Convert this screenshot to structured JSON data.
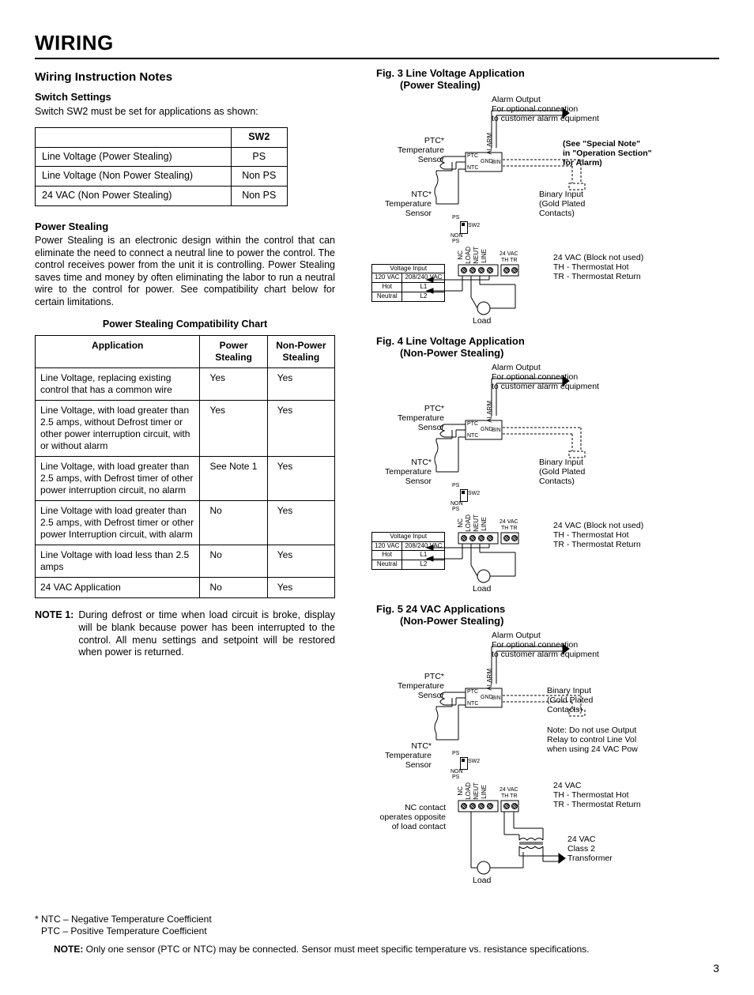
{
  "title": "WIRING",
  "page_number": "3",
  "left": {
    "heading": "Wiring Instruction Notes",
    "switch_heading": "Switch Settings",
    "switch_intro": "Switch SW2 must be set for applications as shown:",
    "sw_table": {
      "header": "SW2",
      "rows": [
        {
          "app": "Line Voltage (Power Stealing)",
          "val": "PS"
        },
        {
          "app": "Line Voltage (Non Power Stealing)",
          "val": "Non PS"
        },
        {
          "app": "24 VAC (Non Power Stealing)",
          "val": "Non PS"
        }
      ]
    },
    "ps_heading": "Power Stealing",
    "ps_text": "Power Stealing is an electronic design within the control that can eliminate the need to connect a neutral line to power the control. The control receives power from the unit it is controlling. Power Stealing saves time and money by often eliminating the labor to run a neutral wire to the control for power. See compatibility chart below for certain limitations.",
    "compat_title": "Power Stealing Compatibility Chart",
    "compat_headers": {
      "c1": "Application",
      "c2": "Power Stealing",
      "c3": "Non-Power Stealing"
    },
    "compat_rows": [
      {
        "app": "Line Voltage, replacing existing control that has a common wire",
        "ps": "Yes",
        "nps": "Yes"
      },
      {
        "app": "Line Voltage, with load greater than 2.5 amps, without Defrost timer or other power interruption circuit, with or without alarm",
        "ps": "Yes",
        "nps": "Yes"
      },
      {
        "app": "Line Voltage, with load greater than 2.5 amps, with Defrost timer of other power interruption circuit, no alarm",
        "ps": "See Note 1",
        "nps": "Yes"
      },
      {
        "app": "Line Voltage with load greater than 2.5 amps, with Defrost timer or other power Interruption circuit, with alarm",
        "ps": "No",
        "nps": "Yes"
      },
      {
        "app": "Line Voltage with load less than 2.5 amps",
        "ps": "No",
        "nps": "Yes"
      },
      {
        "app": "24 VAC Application",
        "ps": "No",
        "nps": "Yes"
      }
    ],
    "note1_label": "NOTE 1:",
    "note1_text": "During defrost or time when load circuit is broke, display will be blank because power has been interrupted to the control. All menu settings and setpoint will be restored when power is returned."
  },
  "figures": {
    "common": {
      "alarm_out": "Alarm Output",
      "alarm_sub1": "For optional connection",
      "alarm_sub2": "to customer alarm equipment",
      "ptc_l1": "PTC*",
      "ptc_l2": "Temperature",
      "ptc_l3": "Sensor",
      "ntc_l1": "NTC*",
      "ntc_l2": "Temperature",
      "ntc_l3": "Sensor",
      "binary_l1": "Binary Input",
      "binary_l2": "(Gold Plated",
      "binary_l3": "Contacts)",
      "vac24_l1": "24 VAC (Block not used)",
      "vac24_l2": "TH - Thermostat Hot",
      "vac24_l3": "TR - Thermostat Return",
      "load": "Load",
      "voltage_input": "Voltage Input",
      "v120": "120 VAC",
      "v208": "208/240 VAC",
      "hot": "Hot",
      "neutral": "Neutral",
      "l1": "L1",
      "l2": "L2",
      "term_ptc": "PTC",
      "term_gnd": "GND",
      "term_ntc": "NTC",
      "term_alarm": "ALARM",
      "term_bin": "BIN",
      "sw_ps": "PS",
      "sw_sw2": "SW2",
      "sw_non": "NON",
      "sw_ps2": "PS",
      "relay_nc": "NC",
      "relay_load": "LOAD",
      "relay_neut": "NEUT",
      "relay_line": "LINE",
      "relay_24": "24 VAC",
      "relay_th": "TH",
      "relay_tr": "TR"
    },
    "fig3": {
      "title_l1": "Fig. 3 Line Voltage Application",
      "title_l2": "(Power Stealing)",
      "special_l1": "(See \"Special Note\"",
      "special_l2": "in \"Operation Section\"",
      "special_l3": "for Alarm)"
    },
    "fig4": {
      "title_l1": "Fig. 4 Line Voltage Application",
      "title_l2": "(Non-Power Stealing)"
    },
    "fig5": {
      "title_l1": "Fig. 5  24 VAC Applications",
      "title_l2": "(Non-Power Stealing)",
      "note_l1": "Note: Do not use Output",
      "note_l2": "Relay to control Line Vol",
      "note_l3": "when using 24 VAC Pow",
      "vac_l1": "24 VAC",
      "vac_l2": "TH - Thermostat Hot",
      "vac_l3": "TR - Thermostat Return",
      "nc_l1": "NC contact",
      "nc_l2": "operates opposite",
      "nc_l3": "of load contact",
      "xfmr_l1": "24 VAC",
      "xfmr_l2": "Class 2",
      "xfmr_l3": "Transformer"
    }
  },
  "footnotes": {
    "star_l1": "* NTC – Negative Temperature Coefficient",
    "star_l2": "PTC – Positive Temperature Coefficient",
    "note_label": "NOTE:",
    "note_text": " Only one sensor (PTC or NTC) may be connected. Sensor must meet specific temperature vs. resistance specifications."
  }
}
